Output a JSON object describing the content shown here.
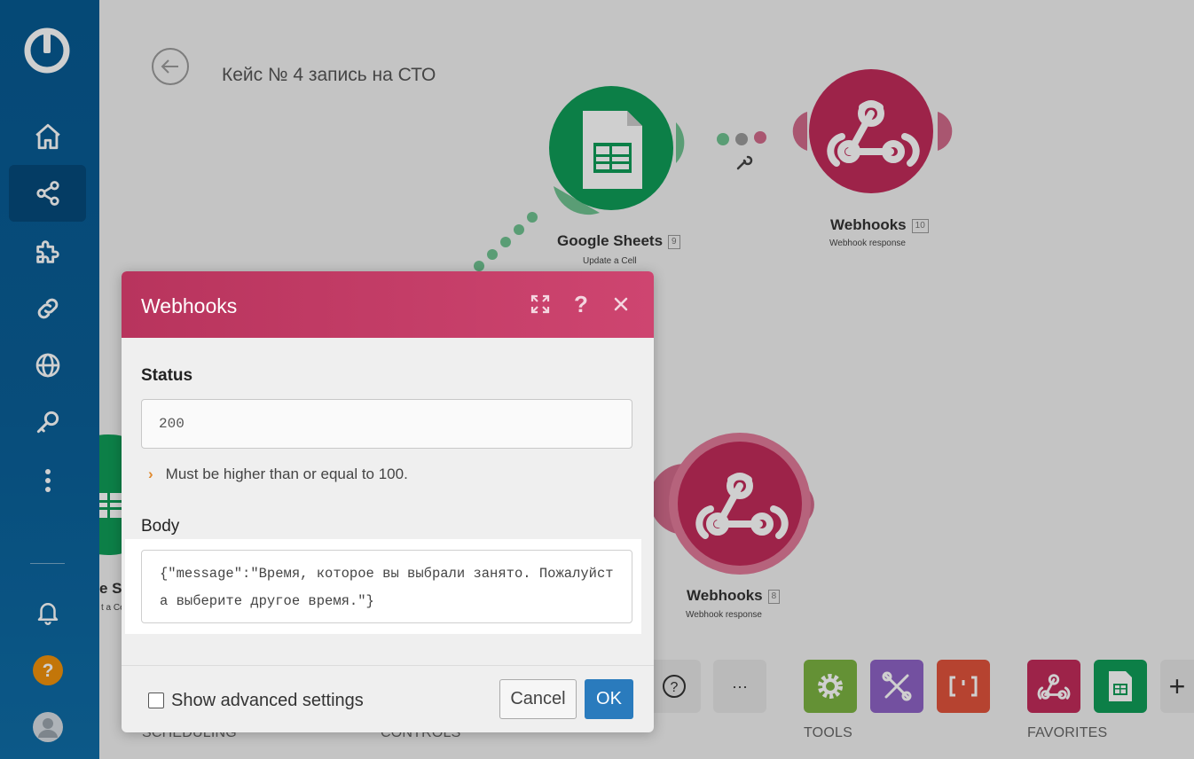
{
  "scenario": {
    "title": "Кейс № 4 запись на СТО"
  },
  "modules": [
    {
      "name": "Google Sheets",
      "number": "9",
      "action": "Update a Cell",
      "color": "#0f9d58"
    },
    {
      "name": "Webhooks",
      "number": "10",
      "action": "Webhook response",
      "color": "#c22c5a"
    },
    {
      "name": "Webhooks",
      "number": "8",
      "action": "Webhook response",
      "color": "#c22c5a"
    },
    {
      "name": "e S",
      "action": "t a Ce"
    }
  ],
  "toolbar": {
    "labels": {
      "scheduling": "SCHEDULING",
      "controls": "CONTROLS",
      "tools": "TOOLS",
      "favorites": "FAVORITES"
    },
    "more": "···",
    "add": "+",
    "colors": {
      "tools1": "#7cb342",
      "tools2": "#8e63c6",
      "tools3": "#e0533c"
    }
  },
  "dialog": {
    "title": "Webhooks",
    "status_label": "Status",
    "status_value": "200",
    "status_hint": "Must be higher than or equal to 100.",
    "body_label": "Body",
    "body_value": "{\"message\":\"Время, которое вы выбрали занято. Пожалуйста выберите другое время.\"}",
    "advanced_label": "Show advanced settings",
    "cancel_label": "Cancel",
    "ok_label": "OK",
    "header_color": "#c13e66"
  }
}
